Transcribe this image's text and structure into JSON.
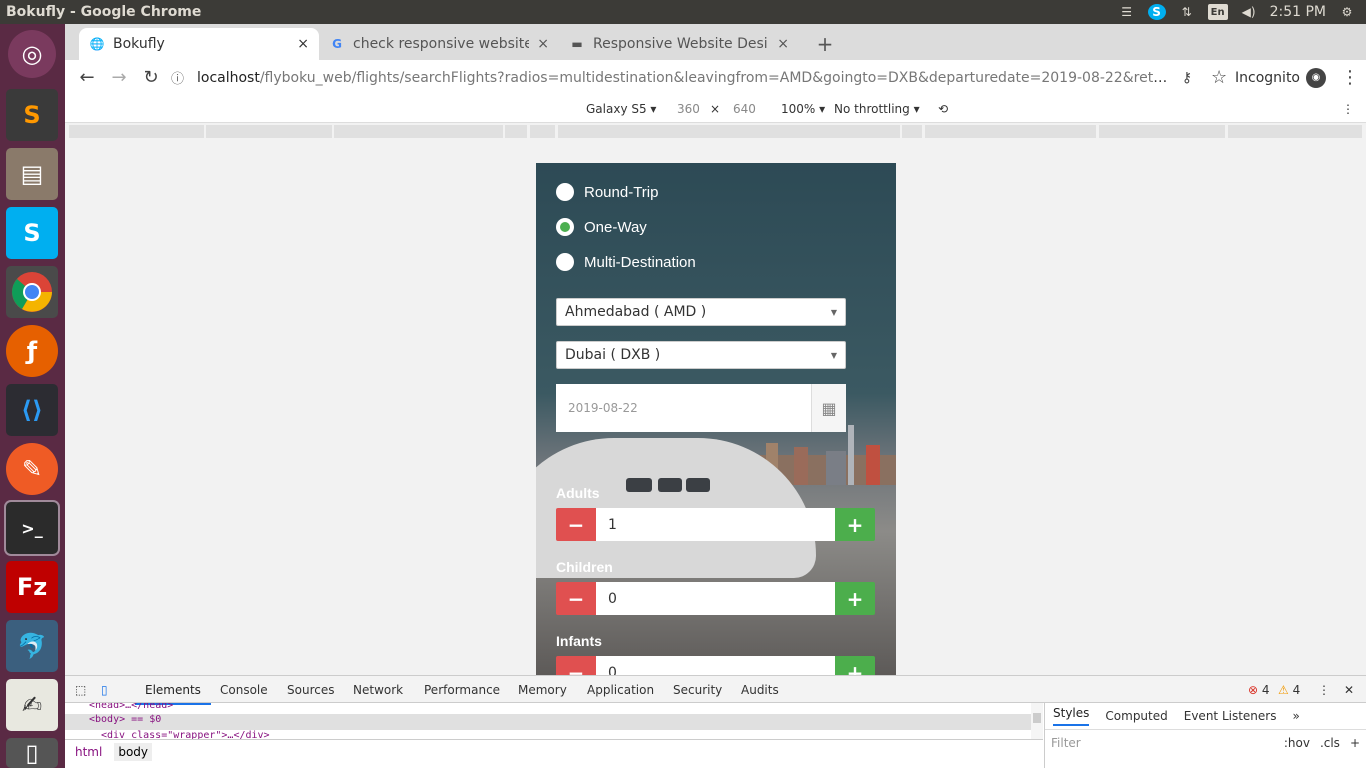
{
  "window": {
    "title": "Bokufly - Google Chrome"
  },
  "tray": {
    "keyboard": "En",
    "clock": "2:51 PM"
  },
  "tabs": [
    {
      "label": "Bokufly",
      "active": true
    },
    {
      "label": "check responsive website",
      "active": false
    },
    {
      "label": "Responsive Website Desi",
      "active": false
    }
  ],
  "tab_close": "×",
  "new_tab": "+",
  "address": {
    "host": "localhost",
    "path": "/flyboku_web/flights/searchFlights?radios=multidestination&leavingfrom=AMD&goingto=DXB&departuredate=2019-08-22&returndat..."
  },
  "incognito_label": "Incognito",
  "device_toolbar": {
    "device": "Galaxy S5",
    "width": "360",
    "times": "×",
    "height": "640",
    "zoom": "100%",
    "throttling": "No throttling"
  },
  "trip_types": [
    {
      "label": "Round-Trip",
      "checked": false
    },
    {
      "label": "One-Way",
      "checked": true
    },
    {
      "label": "Multi-Destination",
      "checked": false
    }
  ],
  "from_select": "Ahmedabad ( AMD )",
  "to_select": "Dubai ( DXB )",
  "departure_date": "2019-08-22",
  "passengers": [
    {
      "label": "Adults",
      "value": "1"
    },
    {
      "label": "Children",
      "value": "0"
    },
    {
      "label": "Infants",
      "value": "0"
    }
  ],
  "stepper_minus": "−",
  "stepper_plus": "+",
  "devtools": {
    "tabs": [
      "Elements",
      "Console",
      "Sources",
      "Network",
      "Performance",
      "Memory",
      "Application",
      "Security",
      "Audits"
    ],
    "errors": "4",
    "warnings": "4",
    "dom": [
      "<head>…</head>",
      "<body> == $0",
      "<div class=\"wrapper\">…</div>"
    ],
    "breadcrumbs": [
      "html",
      "body"
    ],
    "style_tabs": [
      "Styles",
      "Computed",
      "Event Listeners"
    ],
    "filter_placeholder": "Filter",
    "hov": ":hov",
    "cls": ".cls"
  }
}
